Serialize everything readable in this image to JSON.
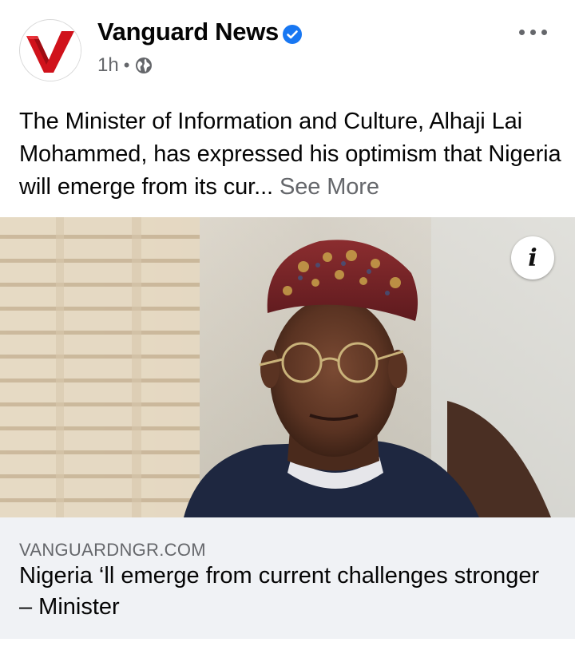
{
  "post": {
    "page_name": "Vanguard News",
    "time": "1h",
    "separator": "•",
    "privacy_icon": "globe-icon",
    "verified_icon": "verified-badge-icon",
    "more_icon": "more-options-icon",
    "caption": "The Minister of Information and Culture, Alhaji Lai Mohammed, has expressed his optimism that Nigeria will emerge from its cur...",
    "see_more": "See More"
  },
  "link_preview": {
    "domain": "VANGUARDNGR.COM",
    "title": "Nigeria ‘ll emerge from current challenges stronger – Minister",
    "info_icon": "info-icon",
    "info_label": "i"
  },
  "colors": {
    "verified_blue": "#1877f2",
    "logo_red": "#d0121b",
    "secondary_text": "#65676b",
    "link_box_bg": "#f0f2f5"
  }
}
